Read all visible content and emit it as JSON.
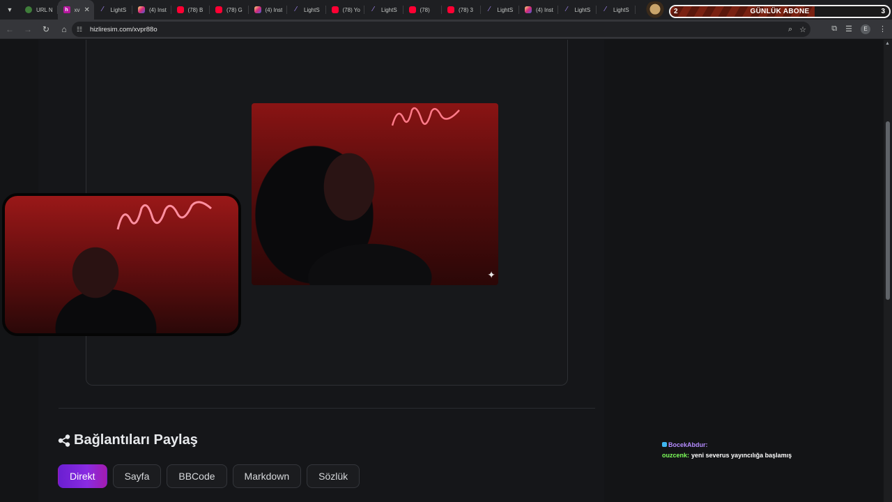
{
  "browser": {
    "tabs": [
      {
        "title": "URL N",
        "favicon": "url-shortener-icon",
        "active": false
      },
      {
        "title": "xv",
        "favicon": "hizliresim-icon",
        "active": true
      },
      {
        "title": "LightS",
        "favicon": "lightshot-icon",
        "active": false
      },
      {
        "title": "(4) Inst",
        "favicon": "instagram-icon",
        "active": false
      },
      {
        "title": "(78) B",
        "favicon": "youtube-icon",
        "active": false
      },
      {
        "title": "(78) G",
        "favicon": "youtube-icon",
        "active": false
      },
      {
        "title": "(4) Inst",
        "favicon": "instagram-icon",
        "active": false
      },
      {
        "title": "LightS",
        "favicon": "lightshot-icon",
        "active": false
      },
      {
        "title": "(78) Yo",
        "favicon": "youtube-icon",
        "active": false
      },
      {
        "title": "LightS",
        "favicon": "lightshot-icon",
        "active": false
      },
      {
        "title": "(78)",
        "favicon": "youtube-icon",
        "active": false
      },
      {
        "title": "(78) 3",
        "favicon": "youtube-icon",
        "active": false
      },
      {
        "title": "LightS",
        "favicon": "lightshot-icon",
        "active": false
      },
      {
        "title": "(4) Inst",
        "favicon": "instagram-icon",
        "active": false
      },
      {
        "title": "LightS",
        "favicon": "lightshot-icon",
        "active": false
      },
      {
        "title": "LightS",
        "favicon": "lightshot-icon",
        "active": false
      }
    ],
    "url": "hizliresim.com/xvpr88o",
    "profile_initial": "E"
  },
  "subscriber_goal": {
    "label": "GÜNLÜK ABONE",
    "current": "2",
    "target": "3",
    "progress": 0.66
  },
  "share": {
    "title": "Bağlantıları Paylaş",
    "tabs": [
      "Direkt",
      "Sayfa",
      "BBCode",
      "Markdown",
      "Sözlük"
    ],
    "active_tab": "Direkt"
  },
  "chat": [
    {
      "user": "BocekAbdur:",
      "message": "",
      "color": "#b58cff"
    },
    {
      "user": "ouzcenk:",
      "message": "yeni severus yayıncılığa başlamış",
      "color": "#7dff5a"
    }
  ],
  "colors": {
    "accent": "#8a2be2",
    "background": "#131416"
  }
}
